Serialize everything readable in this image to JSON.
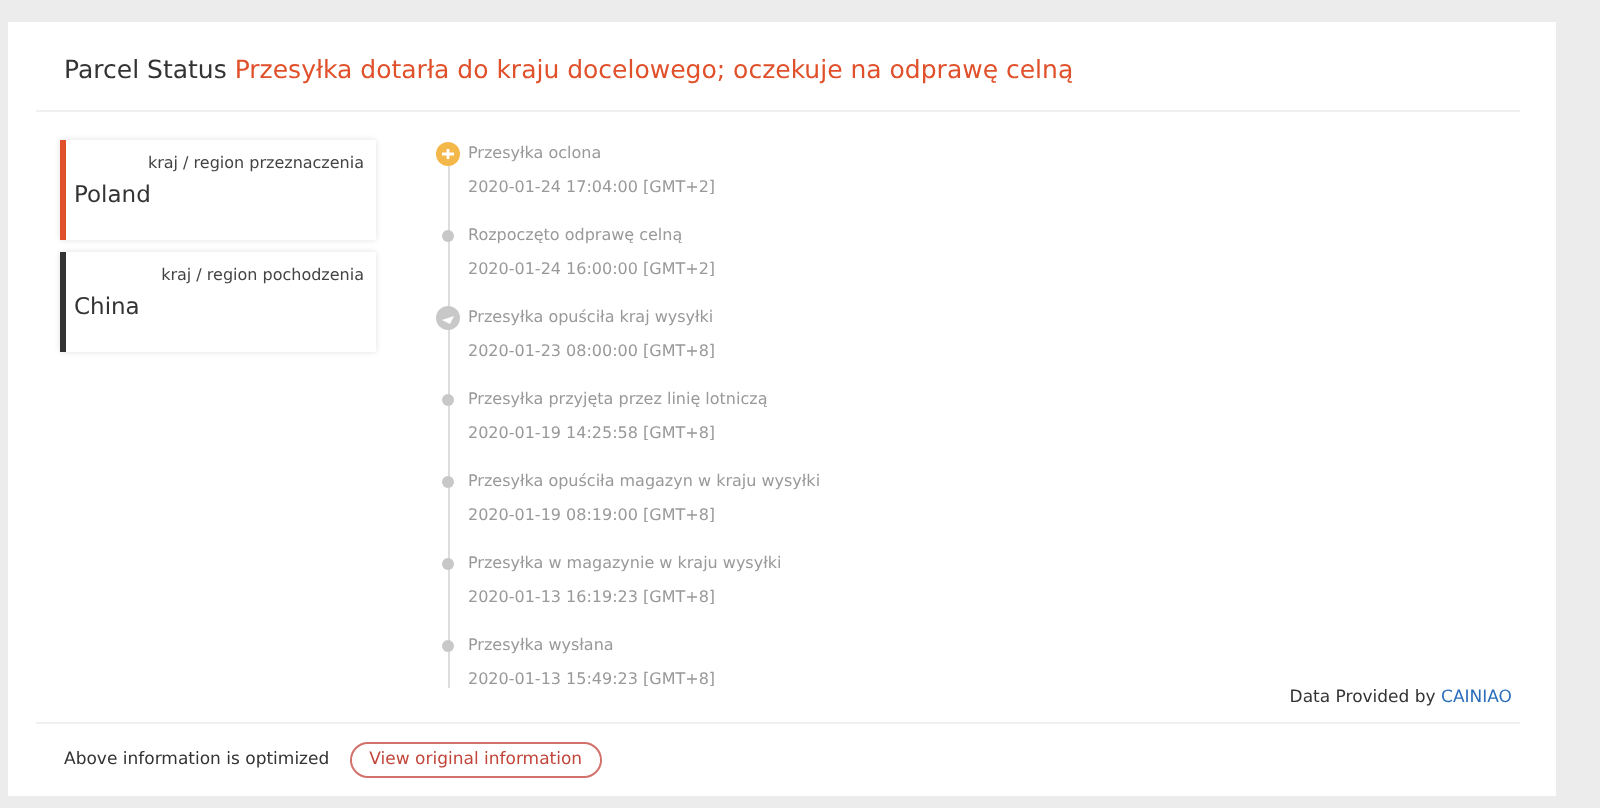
{
  "header": {
    "label": "Parcel Status",
    "status": "Przesyłka dotarła do kraju docelowego; oczekuje na odprawę celną"
  },
  "countries": [
    {
      "caption": "kraj / region przeznaczenia",
      "name": "Poland",
      "color": "#e0502a"
    },
    {
      "caption": "kraj / region pochodzenia",
      "name": "China",
      "color": "#333333"
    }
  ],
  "events": [
    {
      "kind": "highlight",
      "title": "Przesyłka oclona",
      "time": "2020-01-24 17:04:00 [GMT+2]"
    },
    {
      "kind": "dot",
      "title": "Rozpoczęto odprawę celną",
      "time": "2020-01-24 16:00:00 [GMT+2]"
    },
    {
      "kind": "circle",
      "title": "Przesyłka opuściła kraj wysyłki",
      "time": "2020-01-23 08:00:00 [GMT+8]"
    },
    {
      "kind": "dot",
      "title": "Przesyłka przyjęta przez linię lotniczą",
      "time": "2020-01-19 14:25:58 [GMT+8]"
    },
    {
      "kind": "dot",
      "title": "Przesyłka opuściła magazyn w kraju wysyłki",
      "time": "2020-01-19 08:19:00 [GMT+8]"
    },
    {
      "kind": "dot",
      "title": "Przesyłka w magazynie w kraju wysyłki",
      "time": "2020-01-13 16:19:23 [GMT+8]"
    },
    {
      "kind": "dot",
      "title": "Przesyłka wysłana",
      "time": "2020-01-13 15:49:23 [GMT+8]"
    }
  ],
  "provider": {
    "label": "Data Provided by",
    "link": "CAINIAO"
  },
  "footer": {
    "note": "Above information is optimized",
    "button": "View original information"
  }
}
